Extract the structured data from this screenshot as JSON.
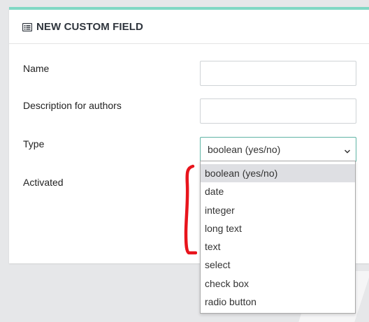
{
  "panel": {
    "title": "NEW CUSTOM FIELD",
    "accent_color": "#80d8c4",
    "icon": "list-icon"
  },
  "form": {
    "name_label": "Name",
    "name_value": "",
    "description_label": "Description for authors",
    "description_value": "",
    "type_label": "Type",
    "type_value": "boolean (yes/no)",
    "activated_label": "Activated"
  },
  "dropdown": {
    "options": [
      "boolean (yes/no)",
      "date",
      "integer",
      "long text",
      "text",
      "select",
      "check box",
      "radio button"
    ],
    "selected_index": 0
  },
  "annotation": {
    "color": "#e8141c",
    "shape": "red-bracket"
  }
}
